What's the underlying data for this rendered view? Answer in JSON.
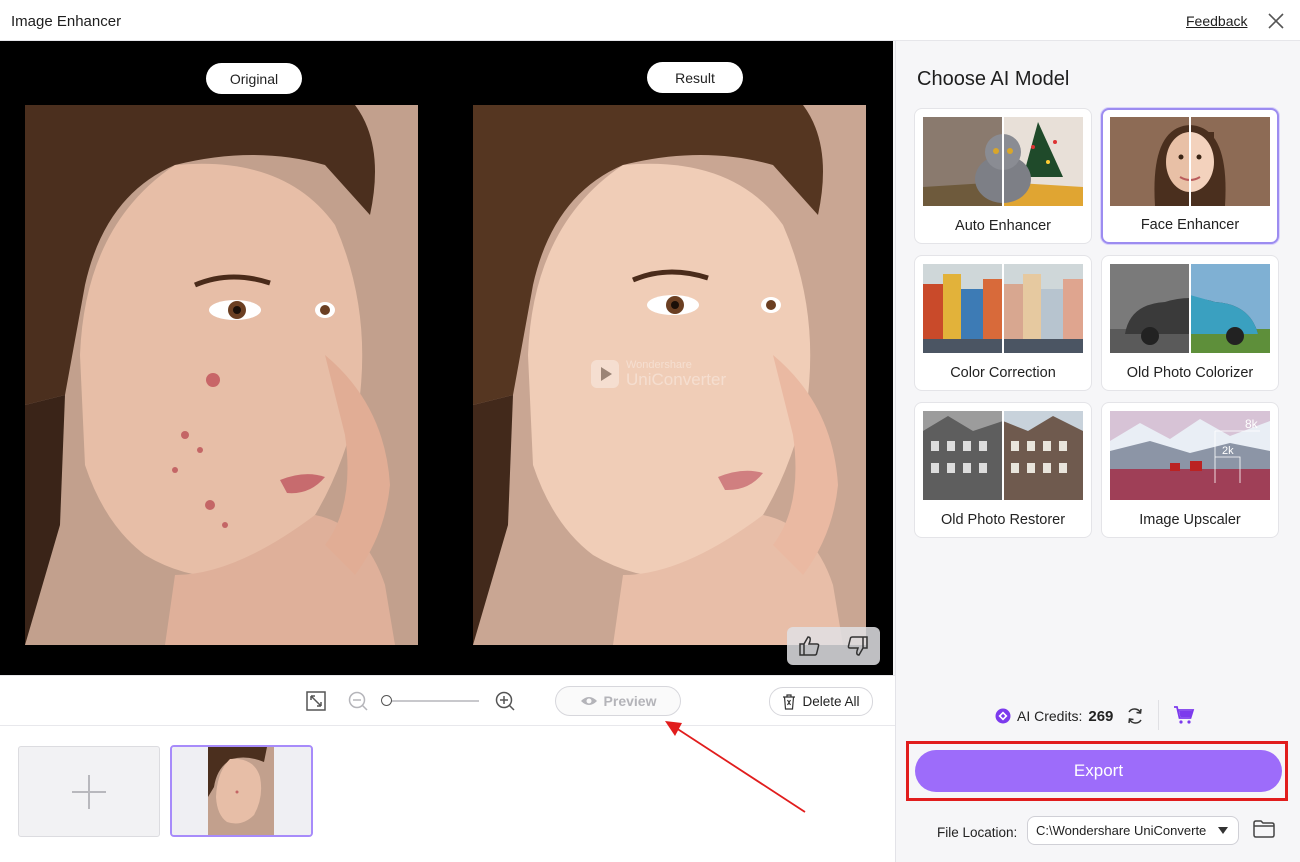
{
  "window": {
    "title": "Image Enhancer",
    "feedback": "Feedback",
    "close_icon": "close-icon"
  },
  "preview": {
    "original_label": "Original",
    "result_label": "Result",
    "watermark_line1": "Wondershare",
    "watermark_line2": "UniConverter",
    "rate_icons": [
      "thumbs-up-icon",
      "thumbs-down-icon"
    ]
  },
  "toolbar": {
    "icons": [
      "fit-screen-icon",
      "zoom-out-icon",
      "zoom-in-icon"
    ],
    "preview_label": "Preview",
    "delete_all_label": "Delete All"
  },
  "panel": {
    "heading": "Choose AI Model",
    "models": [
      {
        "label": "Auto Enhancer",
        "selected": false
      },
      {
        "label": "Face Enhancer",
        "selected": true
      },
      {
        "label": "Color Correction",
        "selected": false
      },
      {
        "label": "Old Photo Colorizer",
        "selected": false
      },
      {
        "label": "Old Photo Restorer",
        "selected": false
      },
      {
        "label": "Image Upscaler",
        "selected": false,
        "badges": [
          "8k",
          "2k"
        ]
      }
    ]
  },
  "footer": {
    "credits_label": "AI Credits:",
    "credits_value": "269",
    "export_label": "Export",
    "file_location_label": "File Location:",
    "file_location_value": "C:\\Wondershare UniConverte"
  },
  "colors": {
    "accent": "#9d6cfa",
    "selected_border": "#9c8cf0",
    "highlight_box": "#e11d1d"
  }
}
